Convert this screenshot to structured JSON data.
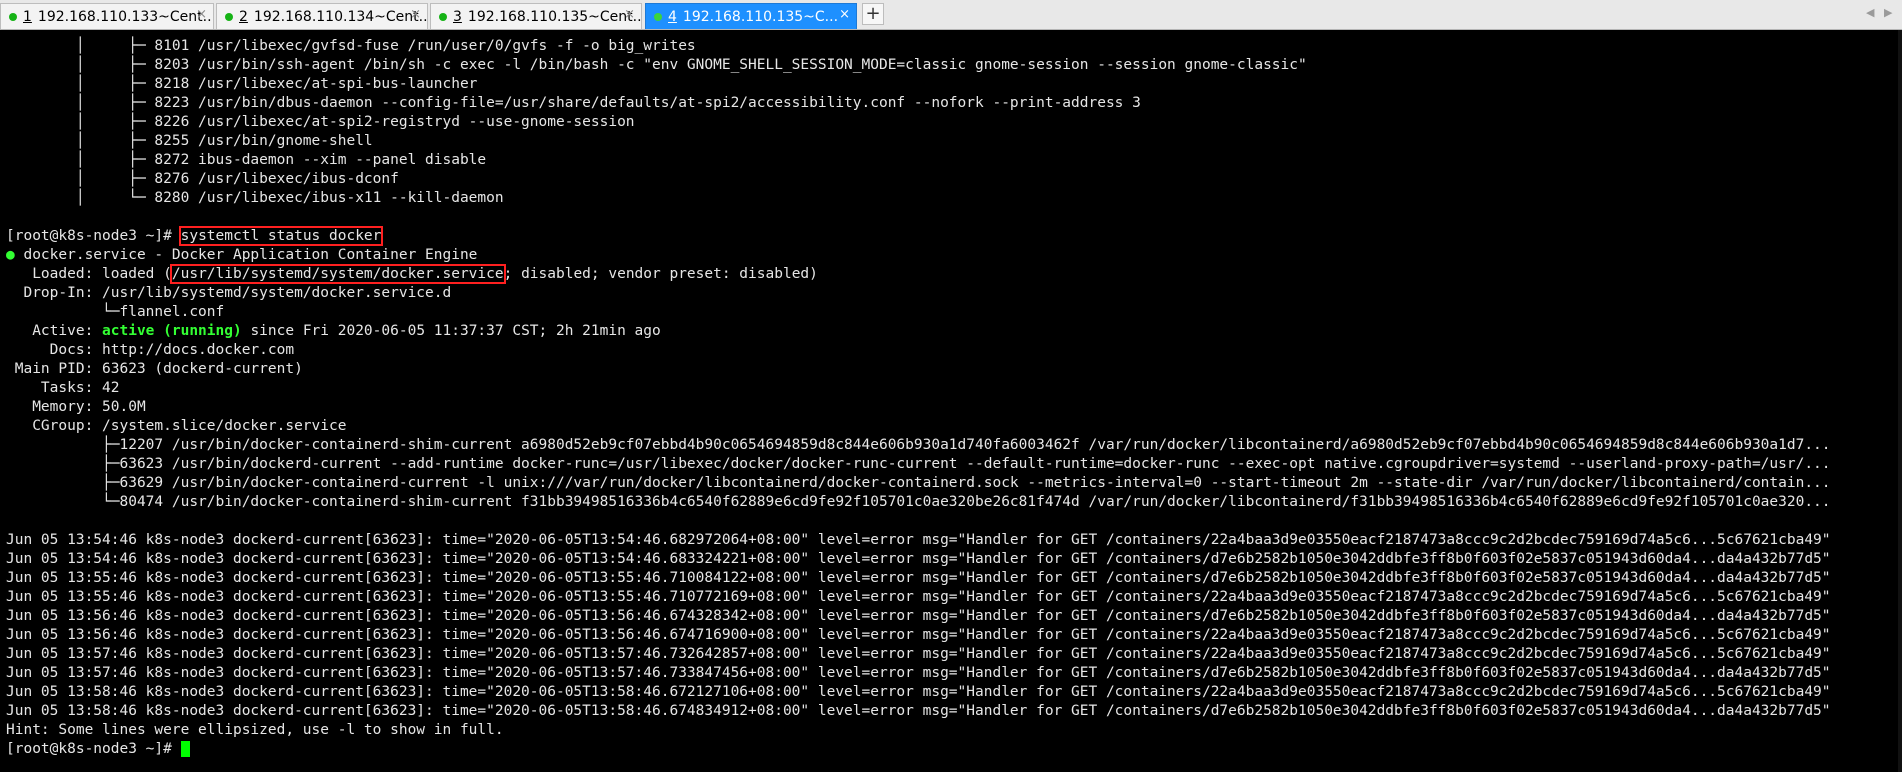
{
  "tabs": [
    {
      "num": "1",
      "title": "192.168.110.133~Cent..."
    },
    {
      "num": "2",
      "title": "192.168.110.134~Cent..."
    },
    {
      "num": "3",
      "title": "192.168.110.135~Cent..."
    },
    {
      "num": "4",
      "title": "192.168.110.135~C..."
    }
  ],
  "add_tab": "+",
  "close_glyph": "×",
  "nav": {
    "left": "◀",
    "right": "▶"
  },
  "tree": [
    "        │     ├─ 8101 /usr/libexec/gvfsd-fuse /run/user/0/gvfs -f -o big_writes",
    "        │     ├─ 8203 /usr/bin/ssh-agent /bin/sh -c exec -l /bin/bash -c \"env GNOME_SHELL_SESSION_MODE=classic gnome-session --session gnome-classic\"",
    "        │     ├─ 8218 /usr/libexec/at-spi-bus-launcher",
    "        │     ├─ 8223 /usr/bin/dbus-daemon --config-file=/usr/share/defaults/at-spi2/accessibility.conf --nofork --print-address 3",
    "        │     ├─ 8226 /usr/libexec/at-spi2-registryd --use-gnome-session",
    "        │     ├─ 8255 /usr/bin/gnome-shell",
    "        │     ├─ 8272 ibus-daemon --xim --panel disable",
    "        │     ├─ 8276 /usr/libexec/ibus-dconf",
    "        │     └─ 8280 /usr/libexec/ibus-x11 --kill-daemon"
  ],
  "prompt": "[root@k8s-node3 ~]# ",
  "command": "systemctl status docker",
  "service_bullet": "●",
  "service_line": " docker.service - Docker Application Container Engine",
  "loaded": {
    "pre": "   Loaded: loaded (",
    "path": "/usr/lib/systemd/system/docker.service",
    "post": "; disabled; vendor preset: disabled)"
  },
  "dropin": "  Drop-In: /usr/lib/systemd/system/docker.service.d",
  "dropin_file": "           └─flannel.conf",
  "active": {
    "pre": "   Active: ",
    "state": "active (running)",
    "post": " since Fri 2020-06-05 11:37:37 CST; 2h 21min ago"
  },
  "docs": "     Docs: http://docs.docker.com",
  "main_pid": " Main PID: 63623 (dockerd-current)",
  "tasks": "    Tasks: 42",
  "memory": "   Memory: 50.0M",
  "cgroup": "   CGroup: /system.slice/docker.service",
  "cgroup_procs": [
    "           ├─12207 /usr/bin/docker-containerd-shim-current a6980d52eb9cf07ebbd4b90c0654694859d8c844e606b930a1d740fa6003462f /var/run/docker/libcontainerd/a6980d52eb9cf07ebbd4b90c0654694859d8c844e606b930a1d7...",
    "           ├─63623 /usr/bin/dockerd-current --add-runtime docker-runc=/usr/libexec/docker/docker-runc-current --default-runtime=docker-runc --exec-opt native.cgroupdriver=systemd --userland-proxy-path=/usr/...",
    "           ├─63629 /usr/bin/docker-containerd-current -l unix:///var/run/docker/libcontainerd/docker-containerd.sock --metrics-interval=0 --start-timeout 2m --state-dir /var/run/docker/libcontainerd/contain...",
    "           └─80474 /usr/bin/docker-containerd-shim-current f31bb39498516336b4c6540f62889e6cd9fe92f105701c0ae320be26c81f474d /var/run/docker/libcontainerd/f31bb39498516336b4c6540f62889e6cd9fe92f105701c0ae320..."
  ],
  "logs": [
    "Jun 05 13:54:46 k8s-node3 dockerd-current[63623]: time=\"2020-06-05T13:54:46.682972064+08:00\" level=error msg=\"Handler for GET /containers/22a4baa3d9e03550eacf2187473a8ccc9c2d2bcdec759169d74a5c6...5c67621cba49\"",
    "Jun 05 13:54:46 k8s-node3 dockerd-current[63623]: time=\"2020-06-05T13:54:46.683324221+08:00\" level=error msg=\"Handler for GET /containers/d7e6b2582b1050e3042ddbfe3ff8b0f603f02e5837c051943d60da4...da4a432b77d5\"",
    "Jun 05 13:55:46 k8s-node3 dockerd-current[63623]: time=\"2020-06-05T13:55:46.710084122+08:00\" level=error msg=\"Handler for GET /containers/d7e6b2582b1050e3042ddbfe3ff8b0f603f02e5837c051943d60da4...da4a432b77d5\"",
    "Jun 05 13:55:46 k8s-node3 dockerd-current[63623]: time=\"2020-06-05T13:55:46.710772169+08:00\" level=error msg=\"Handler for GET /containers/22a4baa3d9e03550eacf2187473a8ccc9c2d2bcdec759169d74a5c6...5c67621cba49\"",
    "Jun 05 13:56:46 k8s-node3 dockerd-current[63623]: time=\"2020-06-05T13:56:46.674328342+08:00\" level=error msg=\"Handler for GET /containers/d7e6b2582b1050e3042ddbfe3ff8b0f603f02e5837c051943d60da4...da4a432b77d5\"",
    "Jun 05 13:56:46 k8s-node3 dockerd-current[63623]: time=\"2020-06-05T13:56:46.674716900+08:00\" level=error msg=\"Handler for GET /containers/22a4baa3d9e03550eacf2187473a8ccc9c2d2bcdec759169d74a5c6...5c67621cba49\"",
    "Jun 05 13:57:46 k8s-node3 dockerd-current[63623]: time=\"2020-06-05T13:57:46.732642857+08:00\" level=error msg=\"Handler for GET /containers/22a4baa3d9e03550eacf2187473a8ccc9c2d2bcdec759169d74a5c6...5c67621cba49\"",
    "Jun 05 13:57:46 k8s-node3 dockerd-current[63623]: time=\"2020-06-05T13:57:46.733847456+08:00\" level=error msg=\"Handler for GET /containers/d7e6b2582b1050e3042ddbfe3ff8b0f603f02e5837c051943d60da4...da4a432b77d5\"",
    "Jun 05 13:58:46 k8s-node3 dockerd-current[63623]: time=\"2020-06-05T13:58:46.672127106+08:00\" level=error msg=\"Handler for GET /containers/22a4baa3d9e03550eacf2187473a8ccc9c2d2bcdec759169d74a5c6...5c67621cba49\"",
    "Jun 05 13:58:46 k8s-node3 dockerd-current[63623]: time=\"2020-06-05T13:58:46.674834912+08:00\" level=error msg=\"Handler for GET /containers/d7e6b2582b1050e3042ddbfe3ff8b0f603f02e5837c051943d60da4...da4a432b77d5\""
  ],
  "hint": "Hint: Some lines were ellipsized, use -l to show in full.",
  "final_prompt": "[root@k8s-node3 ~]# "
}
